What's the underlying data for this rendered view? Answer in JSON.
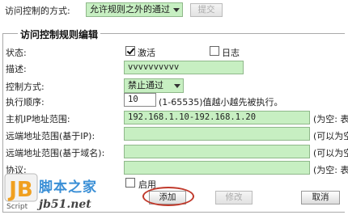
{
  "top": {
    "access_mode_label": "访问控制的方式:",
    "access_mode_value": "允许规则之外的通过",
    "submit_label": "提交"
  },
  "editor": {
    "title": "访问控制规则编辑",
    "status_label": "状态:",
    "enabled_label": "激活",
    "enabled_checked": true,
    "log_label": "日志",
    "log_checked": false,
    "description_label": "描述:",
    "description_value": "vvvvvvvvvv",
    "method_label": "控制方式:",
    "method_value": "禁止通过",
    "order_label": "执行顺序:",
    "order_value": "10",
    "order_hint": "(1-65535)值越小越先被执行。",
    "host_ip_label": "主机IP地址范围:",
    "host_ip_value": "192.168.1.10-192.168.1.20",
    "host_ip_hint": "(为空: 表",
    "remote_ip_label": "远端地址范围(基于IP):",
    "remote_ip_value": "",
    "remote_ip_hint": "(可以为空",
    "remote_domain_label": "远端地址范围(基于域名):",
    "remote_domain_value": "",
    "remote_domain_hint": "(可以为空",
    "protocol_label": "协议:",
    "protocol_value": "",
    "protocol_hint": "(为空: 表",
    "enable_label": "启用",
    "add_label": "添加",
    "modify_label": "修改",
    "cancel_label": "取消"
  },
  "watermark": {
    "logo_text": "JB",
    "script_text": "Script",
    "brand_text": "脚本之家",
    "url_text": "jb51.net"
  }
}
